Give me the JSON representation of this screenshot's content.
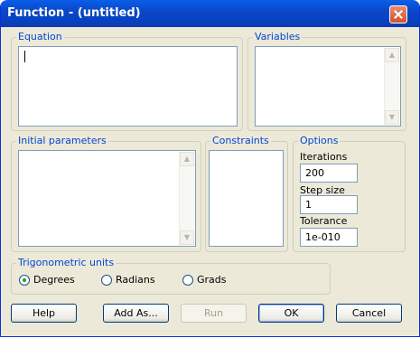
{
  "window": {
    "title": "Function - (untitled)"
  },
  "groups": {
    "equation": "Equation",
    "variables": "Variables",
    "initial_parameters": "Initial parameters",
    "constraints": "Constraints",
    "options": "Options",
    "trig_units": "Trigonometric units"
  },
  "options": {
    "iterations_label": "Iterations",
    "iterations_value": "200",
    "step_size_label": "Step size",
    "step_size_value": "1",
    "tolerance_label": "Tolerance",
    "tolerance_value": "1e-010"
  },
  "trig": {
    "selected": "Degrees",
    "degrees": "Degrees",
    "radians": "Radians",
    "grads": "Grads"
  },
  "buttons": {
    "help": "Help",
    "add_as": "Add As...",
    "run": "Run",
    "ok": "OK",
    "cancel": "Cancel"
  },
  "icons": {
    "close": "close-icon",
    "scroll_up": "scroll-up-arrow-icon",
    "scroll_down": "scroll-down-arrow-icon"
  }
}
